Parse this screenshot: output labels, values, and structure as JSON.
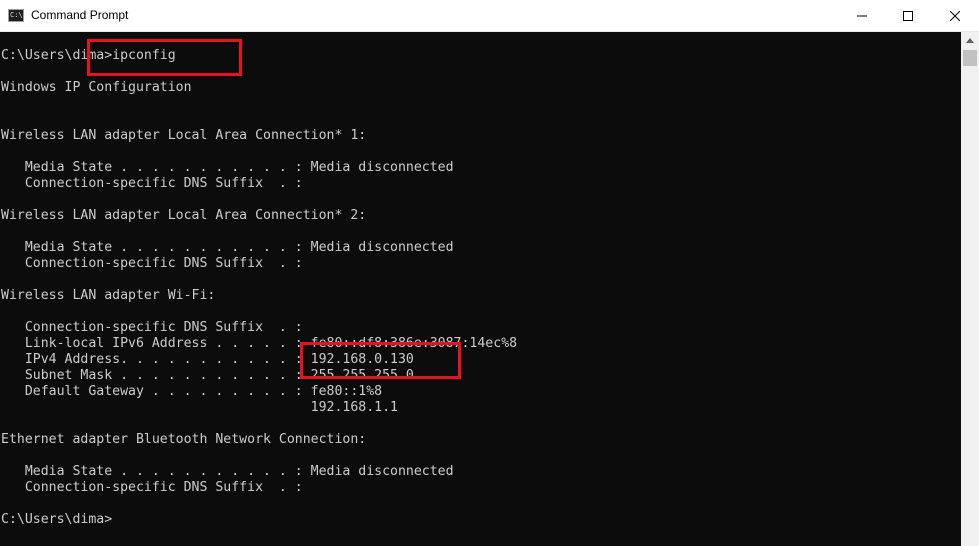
{
  "window": {
    "title": "Command Prompt",
    "app_icon_text": "C:\\",
    "controls": [
      "minimize-icon",
      "maximize-icon",
      "close-icon"
    ]
  },
  "console": {
    "lines": [
      "C:\\Users\\dima>ipconfig",
      "Windows IP Configuration",
      "Wireless LAN adapter Local Area Connection* 1:",
      "   Media State . . . . . . . . . . . : Media disconnected",
      "   Connection-specific DNS Suffix  . :",
      "Wireless LAN adapter Local Area Connection* 2:",
      "   Media State . . . . . . . . . . . : Media disconnected",
      "   Connection-specific DNS Suffix  . :",
      "Wireless LAN adapter Wi-Fi:",
      "   Connection-specific DNS Suffix  . :",
      "   Link-local IPv6 Address . . . . . : fe80::df8:386e:3087:14ec%8",
      "   IPv4 Address. . . . . . . . . . . : 192.168.0.130",
      "   Subnet Mask . . . . . . . . . . . : 255.255.255.0",
      "   Default Gateway . . . . . . . . . : fe80::1%8",
      "                                       192.168.1.1",
      "Ethernet adapter Bluetooth Network Connection:",
      "   Media State . . . . . . . . . . . : Media disconnected",
      "   Connection-specific DNS Suffix  . :",
      "C:\\Users\\dima>"
    ]
  },
  "colors": {
    "console_background": "#0c0c0c",
    "console_text": "#cccccc",
    "highlight": "#e81123",
    "titlebar": "#ffffff"
  }
}
